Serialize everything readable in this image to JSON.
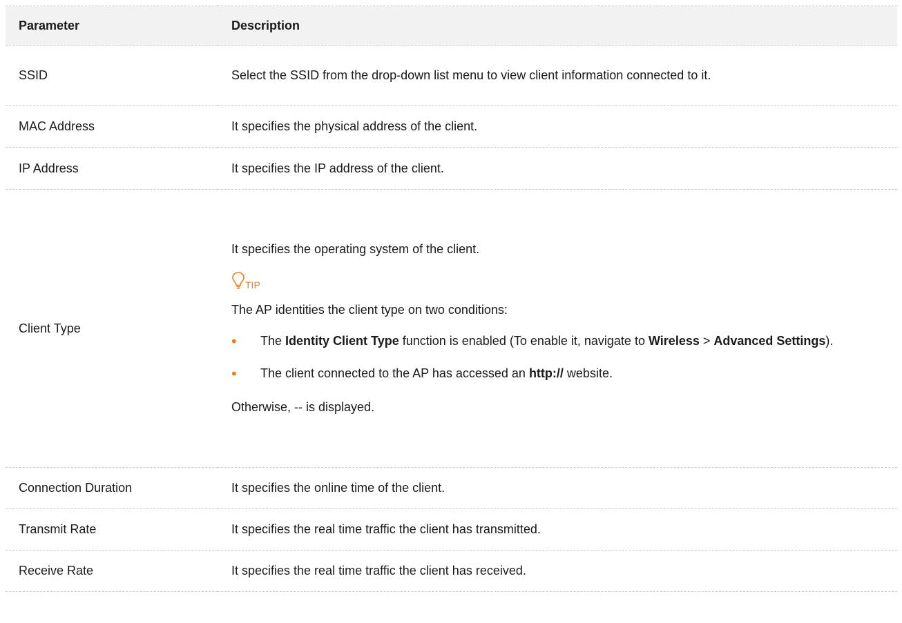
{
  "headers": {
    "parameter": "Parameter",
    "description": "Description"
  },
  "rows": {
    "ssid": {
      "name": "SSID",
      "desc": "Select the SSID from the drop-down list menu to view client information connected to it."
    },
    "mac": {
      "name": "MAC Address",
      "desc": "It specifies the physical address of the client."
    },
    "ip": {
      "name": "IP Address",
      "desc": "It specifies the IP address of the client."
    },
    "client_type": {
      "name": "Client Type",
      "desc_intro": "It specifies the operating system of the client.",
      "tip_label": "TIP",
      "tip_intro": "The AP identities the client type on two conditions:",
      "bullet1": {
        "t1": "The ",
        "b1": "Identity Client Type",
        "t2": " function is enabled (To enable it, navigate to ",
        "b2": "Wireless",
        "t3": " > ",
        "b3": "Advanced Settings",
        "t4": ")."
      },
      "bullet2": {
        "t1": "The client connected to the AP has accessed an ",
        "b1": "http://",
        "t2": " website."
      },
      "otherwise": "Otherwise, -- is displayed."
    },
    "conn": {
      "name": "Connection Duration",
      "desc": "It specifies the online time of the client."
    },
    "tx": {
      "name": "Transmit Rate",
      "desc": "It specifies the real time traffic the client has transmitted."
    },
    "rx": {
      "name": "Receive Rate",
      "desc": "It specifies the real time traffic the client has received."
    }
  },
  "colors": {
    "accent": "#f07c1f",
    "header_bg": "#f2f2f2",
    "rule": "#c8c8c8"
  },
  "icons": {
    "tip": "lightbulb-icon",
    "bullet": "bullet-dot"
  }
}
